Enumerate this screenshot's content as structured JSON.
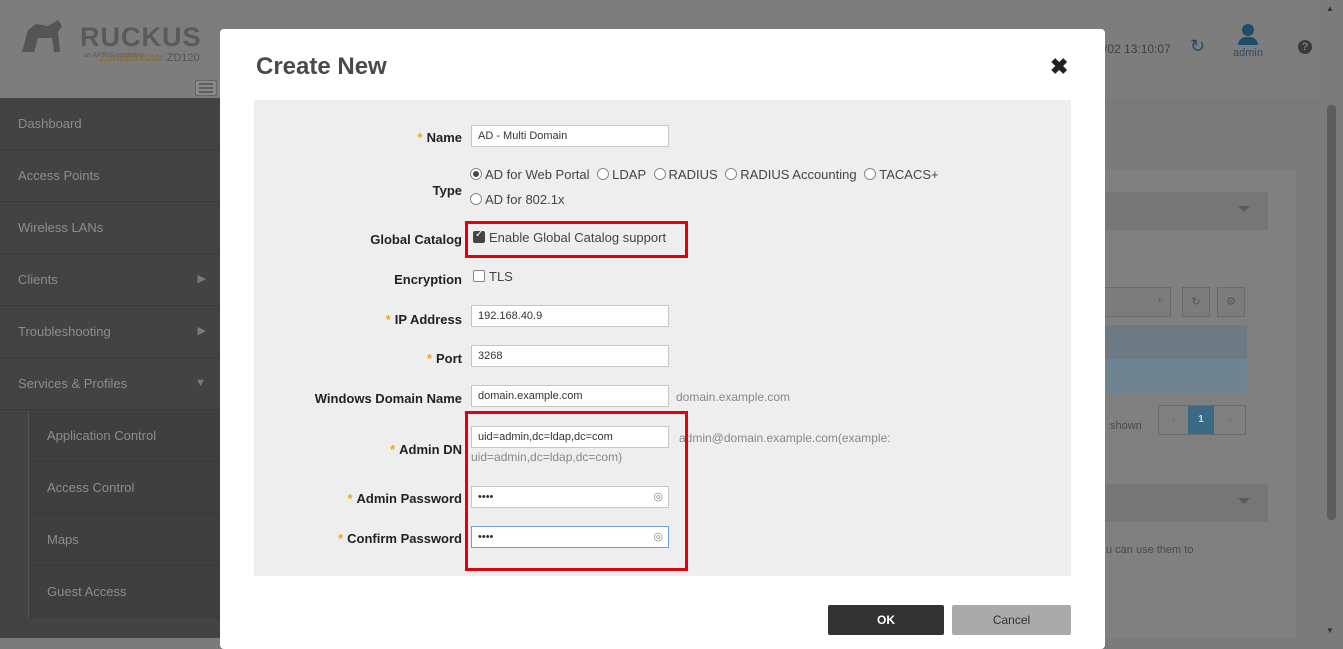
{
  "header": {
    "brand": "RUCKUS",
    "brand_sub": "an ARRIS company",
    "product": "ZoneDirector",
    "model": "ZD120",
    "clock": "/02  13:10:07",
    "user": "admin"
  },
  "sidebar": {
    "items": [
      {
        "label": "Dashboard"
      },
      {
        "label": "Access Points"
      },
      {
        "label": "Wireless LANs"
      },
      {
        "label": "Clients",
        "arrow": "▶"
      },
      {
        "label": "Troubleshooting",
        "arrow": "▶"
      },
      {
        "label": "Services & Profiles",
        "arrow": "▼"
      }
    ],
    "subitems": [
      {
        "label": "Application Control"
      },
      {
        "label": "Access Control"
      },
      {
        "label": "Maps"
      },
      {
        "label": "Guest Access"
      }
    ]
  },
  "background": {
    "shown": "shown",
    "page": "1",
    "note": "u can use them to"
  },
  "modal": {
    "title": "Create New",
    "close": "✖",
    "name": {
      "label": "Name",
      "value": "AD - Multi Domain"
    },
    "type": {
      "label": "Type",
      "options": [
        "AD for Web Portal",
        "LDAP",
        "RADIUS",
        "RADIUS Accounting",
        "TACACS+",
        "AD for 802.1x"
      ],
      "selected": "AD for Web Portal"
    },
    "global_catalog": {
      "label": "Global Catalog",
      "option": "Enable Global Catalog support",
      "checked": true
    },
    "encryption": {
      "label": "Encryption",
      "option": "TLS",
      "checked": false
    },
    "ip_address": {
      "label": "IP Address",
      "value": "192.168.40.9"
    },
    "port": {
      "label": "Port",
      "value": "3268"
    },
    "windows_domain": {
      "label": "Windows Domain Name",
      "value": "domain.example.com",
      "hint": "domain.example.com"
    },
    "admin_dn": {
      "label": "Admin DN",
      "value": "uid=admin,dc=ldap,dc=com",
      "hint_1": "admin@domain.example.com(example:",
      "hint_2": "uid=admin,dc=ldap,dc=com)"
    },
    "admin_password": {
      "label": "Admin Password",
      "value": "••••"
    },
    "confirm_password": {
      "label": "Confirm Password",
      "value": "••••"
    },
    "ok_label": "OK",
    "cancel_label": "Cancel"
  },
  "colors": {
    "required": "#f7a21a",
    "highlight": "#e3000b",
    "ok_button": "#333333",
    "cancel_button": "#aaaaaa"
  }
}
